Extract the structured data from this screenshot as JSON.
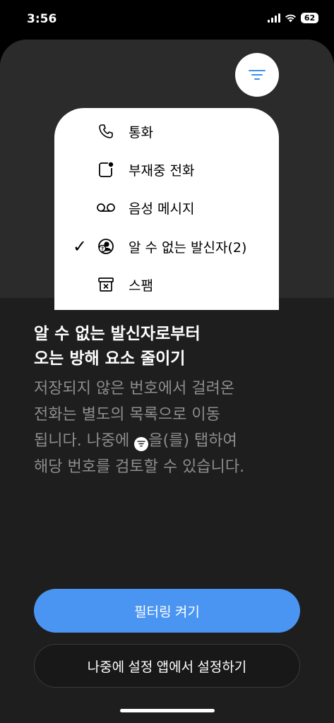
{
  "status_bar": {
    "time": "3:56",
    "battery": "62"
  },
  "filter_button": {
    "icon": "filter-lines-icon"
  },
  "menu": {
    "items": [
      {
        "label": "통화",
        "icon": "phone-icon",
        "checked": false
      },
      {
        "label": "부재중 전화",
        "icon": "missed-call-icon",
        "checked": false
      },
      {
        "label": "음성 메시지",
        "icon": "voicemail-icon",
        "checked": false
      },
      {
        "label": "알 수 없는 발신자(2)",
        "icon": "unknown-caller-icon",
        "checked": true
      },
      {
        "label": "스팸",
        "icon": "spam-icon",
        "checked": false
      }
    ],
    "check_mark": "✓"
  },
  "headline": {
    "line1": "알 수 없는 발신자로부터",
    "line2": "오는 방해 요소 줄이기"
  },
  "description": {
    "line1": "저장되지 않은 번호에서 걸려온",
    "line2": "전화는 별도의 목록으로 이동",
    "line3_before": "됩니다. 나중에 ",
    "line3_after": "을(를) 탭하여",
    "line4": "해당 번호를 검토할 수 있습니다."
  },
  "buttons": {
    "primary": "필터링 켜기",
    "secondary": "나중에 설정 앱에서 설정하기"
  },
  "colors": {
    "accent": "#4a95f2",
    "background": "#1e1e1e",
    "description_text": "#8d8d8d"
  }
}
